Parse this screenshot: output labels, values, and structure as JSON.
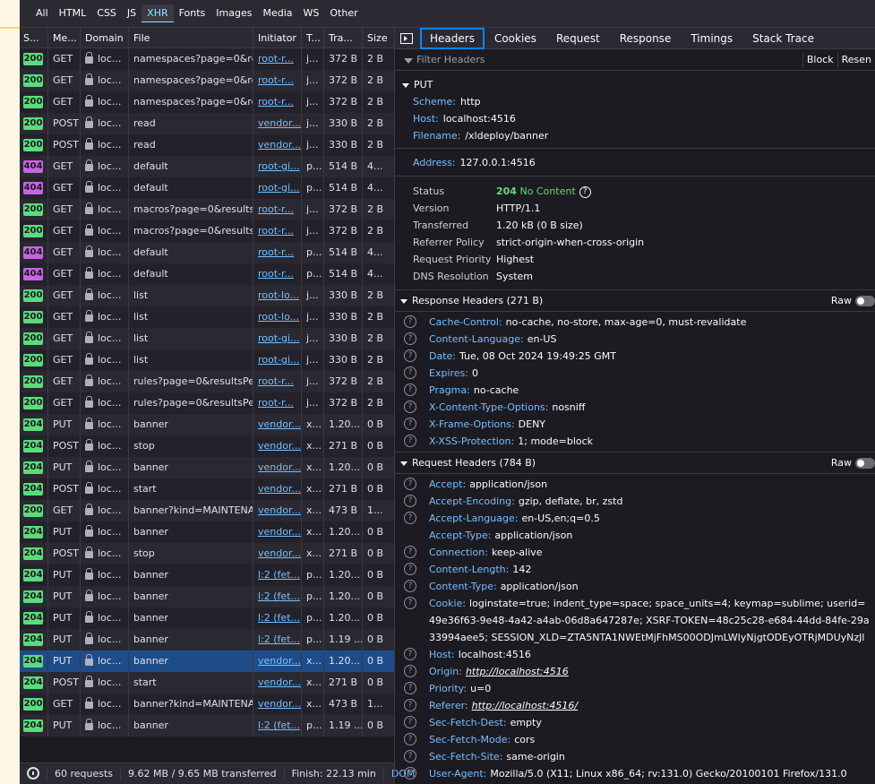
{
  "filter_tabs": [
    "All",
    "HTML",
    "CSS",
    "JS",
    "XHR",
    "Fonts",
    "Images",
    "Media",
    "WS",
    "Other"
  ],
  "active_filter": "XHR",
  "columns": [
    "S...",
    "Me...",
    "Domain",
    "File",
    "Initiator",
    "T...",
    "Tra...",
    "Size"
  ],
  "requests": [
    {
      "status": "200",
      "method": "GET",
      "domain": "loc...",
      "file": "namespaces?page=0&resultsPerPage",
      "initiator": "root-r...",
      "type": "j...",
      "transferred": "372 B",
      "size": "2 B"
    },
    {
      "status": "200",
      "method": "GET",
      "domain": "loc...",
      "file": "namespaces?page=0&resultsPerPage",
      "initiator": "root-r...",
      "type": "j...",
      "transferred": "372 B",
      "size": "2 B"
    },
    {
      "status": "200",
      "method": "GET",
      "domain": "loc...",
      "file": "namespaces?page=0&resultsPerPage",
      "initiator": "root-r...",
      "type": "j...",
      "transferred": "372 B",
      "size": "2 B"
    },
    {
      "status": "200",
      "method": "POST",
      "domain": "loc...",
      "file": "read",
      "initiator": "vendor...",
      "type": "j...",
      "transferred": "330 B",
      "size": "2 B"
    },
    {
      "status": "200",
      "method": "POST",
      "domain": "loc...",
      "file": "read",
      "initiator": "vendor...",
      "type": "j...",
      "transferred": "330 B",
      "size": "2 B"
    },
    {
      "status": "404",
      "method": "GET",
      "domain": "loc...",
      "file": "default",
      "initiator": "root-gi...",
      "type": "p...",
      "transferred": "514 B",
      "size": "4..."
    },
    {
      "status": "404",
      "method": "GET",
      "domain": "loc...",
      "file": "default",
      "initiator": "root-gi...",
      "type": "p...",
      "transferred": "514 B",
      "size": "4..."
    },
    {
      "status": "200",
      "method": "GET",
      "domain": "loc...",
      "file": "macros?page=0&resultsPerPage",
      "initiator": "root-r...",
      "type": "j...",
      "transferred": "372 B",
      "size": "2 B"
    },
    {
      "status": "200",
      "method": "GET",
      "domain": "loc...",
      "file": "macros?page=0&resultsPerPage",
      "initiator": "root-r...",
      "type": "j...",
      "transferred": "372 B",
      "size": "2 B"
    },
    {
      "status": "404",
      "method": "GET",
      "domain": "loc...",
      "file": "default",
      "initiator": "root-r...",
      "type": "p...",
      "transferred": "514 B",
      "size": "4..."
    },
    {
      "status": "404",
      "method": "GET",
      "domain": "loc...",
      "file": "default",
      "initiator": "root-r...",
      "type": "p...",
      "transferred": "514 B",
      "size": "4..."
    },
    {
      "status": "200",
      "method": "GET",
      "domain": "loc...",
      "file": "list",
      "initiator": "root-lo...",
      "type": "j...",
      "transferred": "330 B",
      "size": "2 B"
    },
    {
      "status": "200",
      "method": "GET",
      "domain": "loc...",
      "file": "list",
      "initiator": "root-lo...",
      "type": "j...",
      "transferred": "330 B",
      "size": "2 B"
    },
    {
      "status": "200",
      "method": "GET",
      "domain": "loc...",
      "file": "list",
      "initiator": "root-gi...",
      "type": "j...",
      "transferred": "330 B",
      "size": "2 B"
    },
    {
      "status": "200",
      "method": "GET",
      "domain": "loc...",
      "file": "list",
      "initiator": "root-gi...",
      "type": "j...",
      "transferred": "330 B",
      "size": "2 B"
    },
    {
      "status": "200",
      "method": "GET",
      "domain": "loc...",
      "file": "rules?page=0&resultsPerPage",
      "initiator": "root-r...",
      "type": "j...",
      "transferred": "372 B",
      "size": "2 B"
    },
    {
      "status": "200",
      "method": "GET",
      "domain": "loc...",
      "file": "rules?page=0&resultsPerPage",
      "initiator": "root-r...",
      "type": "j...",
      "transferred": "372 B",
      "size": "2 B"
    },
    {
      "status": "204",
      "method": "PUT",
      "domain": "loc...",
      "file": "banner",
      "initiator": "vendor...",
      "type": "x...",
      "transferred": "1.20...",
      "size": "0 B"
    },
    {
      "status": "204",
      "method": "POST",
      "domain": "loc...",
      "file": "stop",
      "initiator": "vendor...",
      "type": "x...",
      "transferred": "271 B",
      "size": "0 B"
    },
    {
      "status": "204",
      "method": "PUT",
      "domain": "loc...",
      "file": "banner",
      "initiator": "vendor...",
      "type": "x...",
      "transferred": "1.20...",
      "size": "0 B"
    },
    {
      "status": "204",
      "method": "POST",
      "domain": "loc...",
      "file": "start",
      "initiator": "vendor...",
      "type": "x...",
      "transferred": "271 B",
      "size": "0 B"
    },
    {
      "status": "200",
      "method": "GET",
      "domain": "loc...",
      "file": "banner?kind=MAINTENANCE",
      "initiator": "vendor...",
      "type": "x...",
      "transferred": "473 B",
      "size": "1..."
    },
    {
      "status": "204",
      "method": "PUT",
      "domain": "loc...",
      "file": "banner",
      "initiator": "vendor...",
      "type": "x...",
      "transferred": "1.20...",
      "size": "0 B"
    },
    {
      "status": "204",
      "method": "POST",
      "domain": "loc...",
      "file": "stop",
      "initiator": "vendor...",
      "type": "x...",
      "transferred": "271 B",
      "size": "0 B"
    },
    {
      "status": "204",
      "method": "PUT",
      "domain": "loc...",
      "file": "banner",
      "initiator": "l:2 (fet...",
      "type": "p...",
      "transferred": "1.20...",
      "size": "0 B"
    },
    {
      "status": "204",
      "method": "PUT",
      "domain": "loc...",
      "file": "banner",
      "initiator": "l:2 (fet...",
      "type": "p...",
      "transferred": "1.20...",
      "size": "0 B"
    },
    {
      "status": "204",
      "method": "PUT",
      "domain": "loc...",
      "file": "banner",
      "initiator": "l:2 (fet...",
      "type": "p...",
      "transferred": "1.20...",
      "size": "0 B"
    },
    {
      "status": "204",
      "method": "PUT",
      "domain": "loc...",
      "file": "banner",
      "initiator": "l:2 (fet...",
      "type": "p...",
      "transferred": "1.19 ...",
      "size": "0 B"
    },
    {
      "status": "204",
      "method": "PUT",
      "domain": "loc...",
      "file": "banner",
      "initiator": "vendor...",
      "type": "x...",
      "transferred": "1.20...",
      "size": "0 B",
      "selected": true
    },
    {
      "status": "204",
      "method": "POST",
      "domain": "loc...",
      "file": "start",
      "initiator": "vendor...",
      "type": "x...",
      "transferred": "271 B",
      "size": "0 B"
    },
    {
      "status": "200",
      "method": "GET",
      "domain": "loc...",
      "file": "banner?kind=MAINTENANCE",
      "initiator": "vendor...",
      "type": "x...",
      "transferred": "473 B",
      "size": "1..."
    },
    {
      "status": "204",
      "method": "PUT",
      "domain": "loc...",
      "file": "banner",
      "initiator": "l:2 (fet...",
      "type": "p...",
      "transferred": "1.19 ...",
      "size": "0 B"
    }
  ],
  "statusbar": {
    "requests": "60 requests",
    "transferred": "9.62 MB / 9.65 MB transferred",
    "finish": "Finish: 22.13 min",
    "dom": "DOM"
  },
  "detail_tabs": [
    "Headers",
    "Cookies",
    "Request",
    "Response",
    "Timings",
    "Stack Trace"
  ],
  "active_detail_tab": "Headers",
  "filter_placeholder": "Filter Headers",
  "block_label": "Block",
  "resend_label": "Resen",
  "summary": {
    "method": "PUT",
    "scheme_k": "Scheme:",
    "scheme_v": "http",
    "host_k": "Host:",
    "host_v": "localhost:4516",
    "filename_k": "Filename:",
    "filename_v": "/xldeploy/banner",
    "address_k": "Address:",
    "address_v": "127.0.0.1:4516"
  },
  "status_block": [
    {
      "k": "Status",
      "v": ""
    },
    {
      "k": "Version",
      "v": "HTTP/1.1"
    },
    {
      "k": "Transferred",
      "v": "1.20 kB (0 B size)"
    },
    {
      "k": "Referrer Policy",
      "v": "strict-origin-when-cross-origin"
    },
    {
      "k": "Request Priority",
      "v": "Highest"
    },
    {
      "k": "DNS Resolution",
      "v": "System"
    }
  ],
  "status_code": "204",
  "status_text": "No Content",
  "response_headers_title": "Response Headers (271 B)",
  "raw_label": "Raw",
  "response_headers": [
    {
      "k": "Cache-Control:",
      "v": "no-cache, no-store, max-age=0, must-revalidate"
    },
    {
      "k": "Content-Language:",
      "v": "en-US"
    },
    {
      "k": "Date:",
      "v": "Tue, 08 Oct 2024 19:49:25 GMT"
    },
    {
      "k": "Expires:",
      "v": "0"
    },
    {
      "k": "Pragma:",
      "v": "no-cache"
    },
    {
      "k": "X-Content-Type-Options:",
      "v": "nosniff"
    },
    {
      "k": "X-Frame-Options:",
      "v": "DENY"
    },
    {
      "k": "X-XSS-Protection:",
      "v": "1; mode=block"
    }
  ],
  "request_headers_title": "Request Headers (784 B)",
  "request_headers": [
    {
      "k": "Accept:",
      "v": "application/json",
      "q": true
    },
    {
      "k": "Accept-Encoding:",
      "v": "gzip, deflate, br, zstd",
      "q": true
    },
    {
      "k": "Accept-Language:",
      "v": "en-US,en;q=0.5",
      "q": true
    },
    {
      "k": "Accept-Type:",
      "v": "application/json",
      "q": false
    },
    {
      "k": "Connection:",
      "v": "keep-alive",
      "q": true
    },
    {
      "k": "Content-Length:",
      "v": "142",
      "q": true
    },
    {
      "k": "Content-Type:",
      "v": "application/json",
      "q": true
    },
    {
      "k": "Cookie:",
      "v": "loginstate=true; indent_type=space; space_units=4; keymap=sublime; userid=49e36f63-9e48-4a42-a4ab-06d8a647287e; XSRF-TOKEN=48c25c28-e684-44dd-84fe-29a33994aee5; SESSION_XLD=ZTA5NTA1NWEtMjFhMS00ODJmLWIyNjgtODEyOTRjMDUyNzJl",
      "q": true
    },
    {
      "k": "Host:",
      "v": "localhost:4516",
      "q": true
    },
    {
      "k": "Origin:",
      "v": "http://localhost:4516",
      "q": true,
      "u": true
    },
    {
      "k": "Priority:",
      "v": "u=0",
      "q": true
    },
    {
      "k": "Referer:",
      "v": "http://localhost:4516/",
      "q": true,
      "u": true
    },
    {
      "k": "Sec-Fetch-Dest:",
      "v": "empty",
      "q": true
    },
    {
      "k": "Sec-Fetch-Mode:",
      "v": "cors",
      "q": true
    },
    {
      "k": "Sec-Fetch-Site:",
      "v": "same-origin",
      "q": true
    },
    {
      "k": "User-Agent:",
      "v": "Mozilla/5.0 (X11; Linux x86_64; rv:131.0) Gecko/20100101 Firefox/131.0",
      "q": true
    }
  ],
  "help_glyph": "?"
}
